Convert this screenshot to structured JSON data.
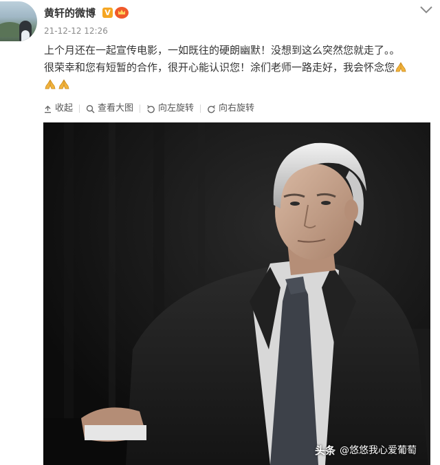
{
  "post": {
    "author": "黄轩的微博",
    "verified_badge": "V",
    "timestamp": "21-12-12 12:26",
    "text_lines": [
      "上个月还在一起宣传电影，一如既往的硬朗幽默！没想到这么突然您就走了。。",
      "很荣幸和您有短暂的合作，很开心能认识您！涂们老师一路走好，我会怀念您"
    ],
    "emoji": "folded-hands-icon"
  },
  "toolbar": {
    "collapse_label": "收起",
    "view_large_label": "查看大图",
    "rotate_left_label": "向左旋转",
    "rotate_right_label": "向右旋转"
  },
  "watermark": {
    "brand": "头条",
    "handle": "@悠悠我心爱葡萄"
  },
  "colors": {
    "text": "#333333",
    "muted": "#8a8a8a",
    "verified": "#f5a623",
    "photo_bg": "#121212"
  }
}
